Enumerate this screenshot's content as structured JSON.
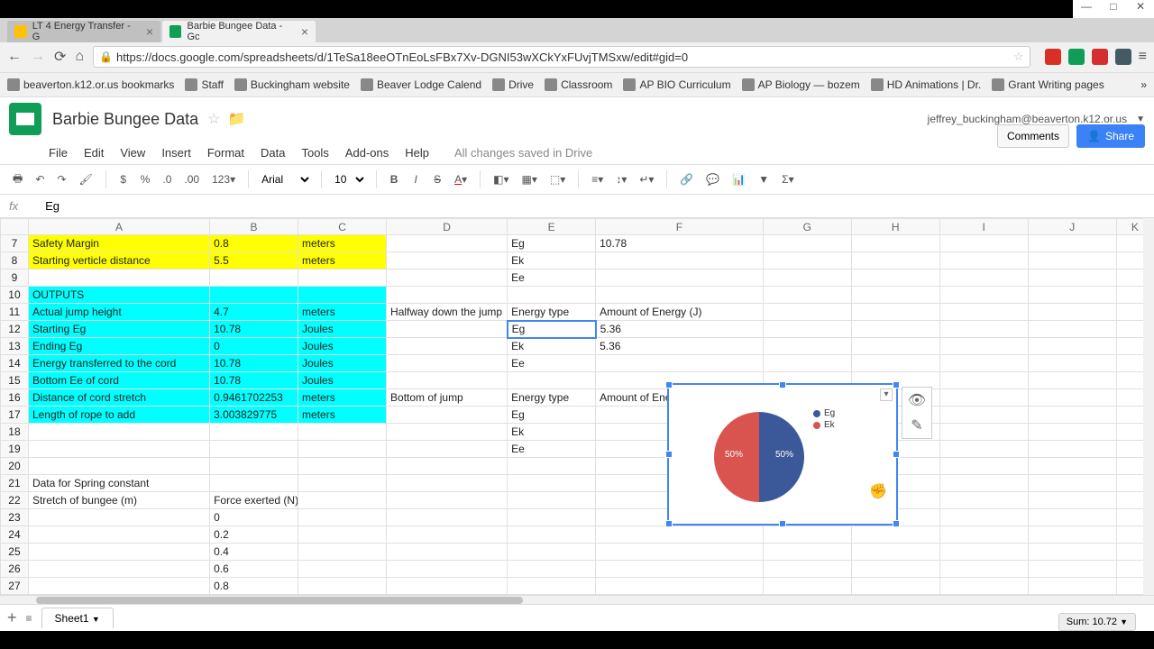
{
  "window": {
    "tabs": [
      {
        "label": "LT 4 Energy Transfer - G"
      },
      {
        "label": "Barbie Bungee Data - Gc"
      }
    ]
  },
  "url": "https://docs.google.com/spreadsheets/d/1TeSa18eeOTnEoLsFBx7Xv-DGNI53wXCkYxFUvjTMSxw/edit#gid=0",
  "bookmarks": [
    "beaverton.k12.or.us bookmarks",
    "Staff",
    "Buckingham website",
    "Beaver Lodge Calend",
    "Drive",
    "Classroom",
    "AP BIO Curriculum",
    "AP Biology — bozem",
    "HD Animations | Dr.",
    "Grant Writing pages"
  ],
  "doc": {
    "title": "Barbie Bungee Data",
    "user": "jeffrey_buckingham@beaverton.k12.or.us",
    "saveStatus": "All changes saved in Drive"
  },
  "menu": [
    "File",
    "Edit",
    "View",
    "Insert",
    "Format",
    "Data",
    "Tools",
    "Add-ons",
    "Help"
  ],
  "buttons": {
    "comments": "Comments",
    "share": "Share"
  },
  "toolbar": {
    "font": "Arial",
    "size": "10"
  },
  "fx": {
    "label": "fx",
    "value": "Eg"
  },
  "cols": [
    "",
    "A",
    "B",
    "C",
    "D",
    "E",
    "F",
    "G",
    "H",
    "I",
    "J",
    "K"
  ],
  "rows": [
    {
      "n": 7,
      "cls": "yellow",
      "A": "Safety Margin",
      "B": "0.8",
      "C": "meters",
      "E": "Eg",
      "F": "10.78"
    },
    {
      "n": 8,
      "cls": "yellow",
      "A": "Starting verticle distance",
      "B": "5.5",
      "C": "meters",
      "E": "Ek"
    },
    {
      "n": 9,
      "E": "Ee"
    },
    {
      "n": 10,
      "cls": "cyan",
      "A": "OUTPUTS"
    },
    {
      "n": 11,
      "cls": "cyan",
      "A": "Actual jump height",
      "B": "4.7",
      "C": "meters",
      "D": "Halfway down the jump",
      "E": "Energy type",
      "F": "Amount of Energy (J)"
    },
    {
      "n": 12,
      "cls": "cyan",
      "A": "Starting Eg",
      "B": "10.78",
      "C": "Joules",
      "E": "Eg",
      "F": "5.36",
      "sel": true
    },
    {
      "n": 13,
      "cls": "cyan",
      "A": "Ending Eg",
      "B": "0",
      "C": "Joules",
      "E": "Ek",
      "F": "5.36"
    },
    {
      "n": 14,
      "cls": "cyan",
      "A": "Energy transferred to the cord",
      "B": "10.78",
      "C": "Joules",
      "E": "Ee"
    },
    {
      "n": 15,
      "cls": "cyan",
      "A": "Bottom Ee of cord",
      "B": "10.78",
      "C": "Joules"
    },
    {
      "n": 16,
      "cls": "cyan",
      "A": "Distance of cord stretch",
      "B": "0.9461702253",
      "C": "meters",
      "D": "Bottom of jump",
      "E": "Energy type",
      "F": "Amount of Energy (J)"
    },
    {
      "n": 17,
      "cls": "cyan",
      "A": "Length of rope to add",
      "B": "3.003829775",
      "C": "meters",
      "E": "Eg"
    },
    {
      "n": 18,
      "E": "Ek"
    },
    {
      "n": 19,
      "E": "Ee"
    },
    {
      "n": 20
    },
    {
      "n": 21,
      "A": "Data for Spring constant"
    },
    {
      "n": 22,
      "A": "Stretch of bungee (m)",
      "B": "Force exerted (N)",
      "Bleft": true
    },
    {
      "n": 23,
      "B": "0"
    },
    {
      "n": 24,
      "B": "0.2"
    },
    {
      "n": 25,
      "B": "0.4"
    },
    {
      "n": 26,
      "B": "0.6"
    },
    {
      "n": 27,
      "B": "0.8"
    }
  ],
  "sheet": {
    "name": "Sheet1"
  },
  "status": {
    "sum": "Sum: 10.72"
  },
  "chart_data": {
    "type": "pie",
    "categories": [
      "Eg",
      "Ek"
    ],
    "values": [
      5.36,
      5.36
    ],
    "percentages": [
      50,
      50
    ],
    "colors": [
      "#3b5998",
      "#d9534f"
    ],
    "title": "",
    "legend_position": "right"
  }
}
